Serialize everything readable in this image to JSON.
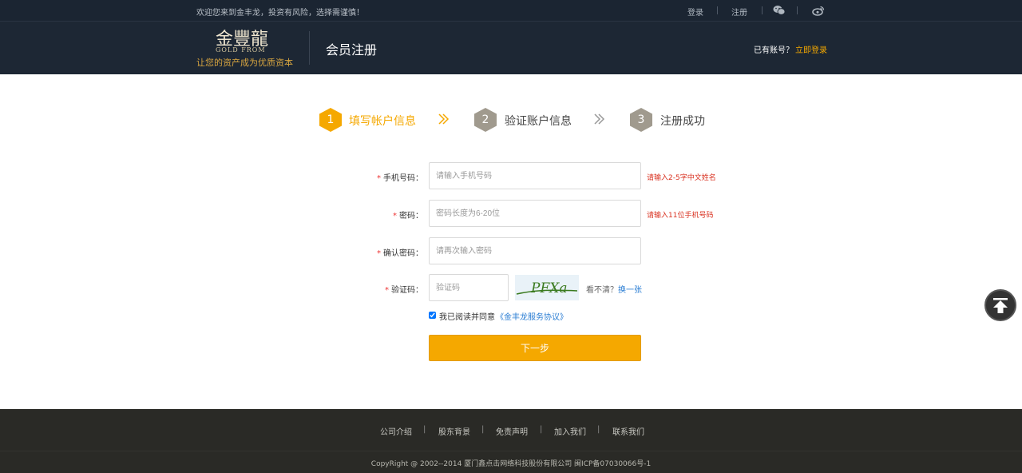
{
  "topbar": {
    "welcome": "欢迎您来到金丰龙，投资有风险，选择需谨慎！",
    "login": "登录",
    "register": "注册",
    "icons": [
      "wechat-icon",
      "weibo-icon"
    ]
  },
  "header": {
    "logo_mark": "金豐龍",
    "logo_en": "GOLD FROM",
    "slogan": "让您的资产成为优质资本",
    "page_title": "会员注册",
    "login_hint": "已有账号？",
    "login_link": "立即登录"
  },
  "steps": [
    {
      "num": "1",
      "label": "填写帐户信息",
      "active": true
    },
    {
      "num": "2",
      "label": "验证账户信息",
      "active": false
    },
    {
      "num": "3",
      "label": "注册成功",
      "active": false
    }
  ],
  "form": {
    "phone": {
      "label": "手机号码：",
      "placeholder": "请输入手机号码",
      "hint": "请输入2-5字中文姓名"
    },
    "password": {
      "label": "密码：",
      "placeholder": "密码长度为6-20位",
      "hint": "请输入11位手机号码"
    },
    "confirm": {
      "label": "确认密码：",
      "placeholder": "请再次输入密码"
    },
    "captcha": {
      "label": "验证码：",
      "placeholder": "验证码",
      "image_text": "PFXa",
      "unclear": "看不清？",
      "refresh": "换一张"
    },
    "agree": {
      "text": "我已阅读并同意",
      "link": "《金丰龙服务协议》",
      "checked": true
    },
    "next": "下一步"
  },
  "footer": {
    "links": [
      "公司介绍",
      "股东背景",
      "免责声明",
      "加入我们",
      "联系我们"
    ],
    "copyright": "CopyRight @ 2002--2014 厦门鑫点击网络科技股份有限公司  闽ICP备07030066号-1"
  },
  "colors": {
    "accent": "#f5a800",
    "header_bg": "#1d2734",
    "footer_bg": "#2a2a26",
    "error": "#d9301f",
    "link": "#2a7dd3"
  }
}
